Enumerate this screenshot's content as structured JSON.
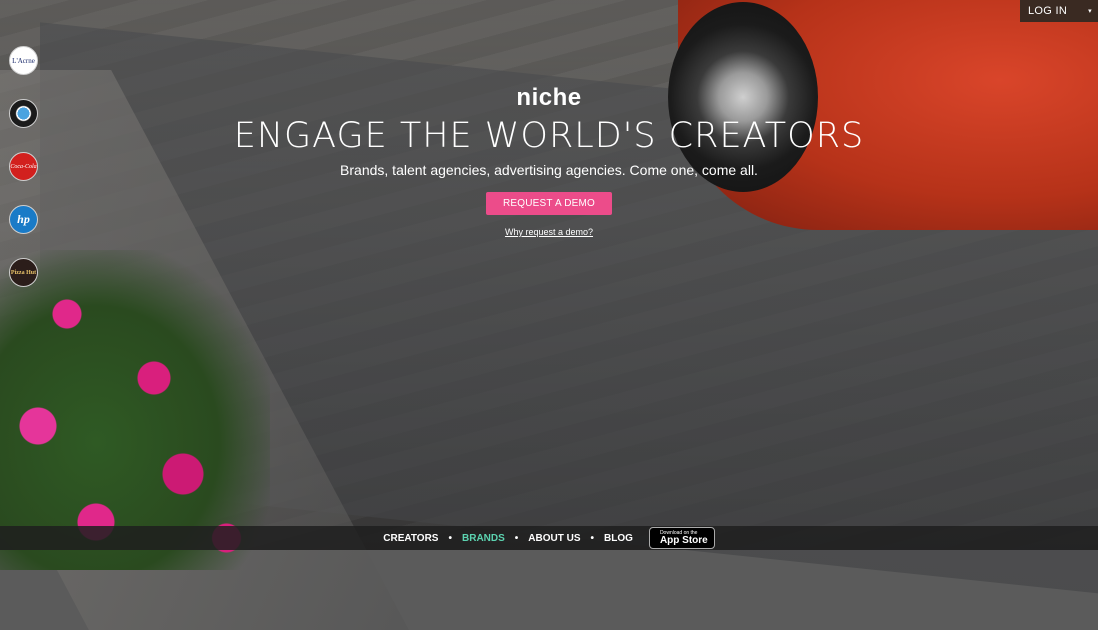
{
  "header": {
    "login_label": "LOG IN",
    "login_caret": "▾"
  },
  "brands": [
    {
      "name": "Lucerne",
      "label": "L'Acrne"
    },
    {
      "name": "BMW",
      "label": ""
    },
    {
      "name": "Coca-Cola",
      "label": "Coca-Cola"
    },
    {
      "name": "HP",
      "label": "hp"
    },
    {
      "name": "Pizza Hut",
      "label": "Pizza Hut"
    }
  ],
  "hero": {
    "logo": "niche",
    "headline": "ENGAGE THE WORLD'S CREATORS",
    "subheadline": "Brands, talent agencies, advertising agencies. Come one, come all.",
    "cta_label": "REQUEST A DEMO",
    "why_link": "Why request a demo?"
  },
  "footer": {
    "nav": [
      {
        "label": "CREATORS"
      },
      {
        "label": "BRANDS"
      },
      {
        "label": "ABOUT US"
      },
      {
        "label": "BLOG"
      }
    ],
    "separator": "•",
    "appstore_small": "Download on the",
    "appstore_big": "App Store",
    "apple_icon": ""
  },
  "colors": {
    "accent_pink": "#ec4c8a",
    "active_nav": "#5cd3b0"
  }
}
